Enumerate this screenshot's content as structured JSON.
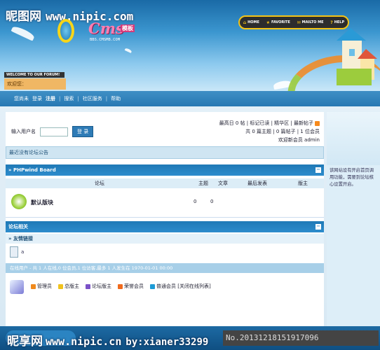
{
  "watermark": {
    "top_brand": "昵图网",
    "top_url": "www.nipic.com",
    "bottom_brand": "昵享网",
    "bottom_url": "www.nipic.cn",
    "user": "by:xianer33299",
    "id": "No.20131218151917096"
  },
  "logo": {
    "main": "Cms",
    "badge": "模板",
    "sub": "BBS.CMSMB.COM"
  },
  "topnav": {
    "items": [
      "HOME",
      "FAVORITE",
      "MAILTO ME",
      "HELP"
    ]
  },
  "welcome_bar": "WELCOME TO OUR FORUM!",
  "greeting": "欢迎您：",
  "navbar": [
    "您尚未",
    "登录",
    "注册",
    "搜索",
    "社区服务",
    "帮助"
  ],
  "login": {
    "label": "输入用户名",
    "button": "登 录"
  },
  "stats": {
    "line1": "最高日 0 帖 | 标记已读 | 精华区 | 最新帖子",
    "line2": "共 0 篇主题 | 0 篇帖子 | 1 位会员",
    "line3": "欢迎新会员 admin"
  },
  "notice": "最近没有论坛公告",
  "category1": {
    "title": "» PHPwind Board"
  },
  "columns": [
    "论坛",
    "主题",
    "文章",
    "最后发表",
    "版主"
  ],
  "forum": {
    "name": "默认版块",
    "topics": "0",
    "posts": "0"
  },
  "category2": {
    "title": "论坛相关"
  },
  "links_title": "» 友情链接",
  "links_text": "a",
  "online": "在线用户 - 共 1 人在线,0 位会员,1 位访客,最多 1 人发生在 1970-01-01 00:00",
  "legend": [
    {
      "label": "管理员",
      "color": "#f08a1d"
    },
    {
      "label": "总版主",
      "color": "#f0c21d"
    },
    {
      "label": "论坛版主",
      "color": "#7b52c8"
    },
    {
      "label": "荣誉会员",
      "color": "#f06a1d"
    },
    {
      "label": "普通会员 [关闭在线列表]",
      "color": "#1d9bd6"
    }
  ],
  "sidebar_text": "该网站设有开启首页调用功能，需要到论坛核心设置开启。"
}
